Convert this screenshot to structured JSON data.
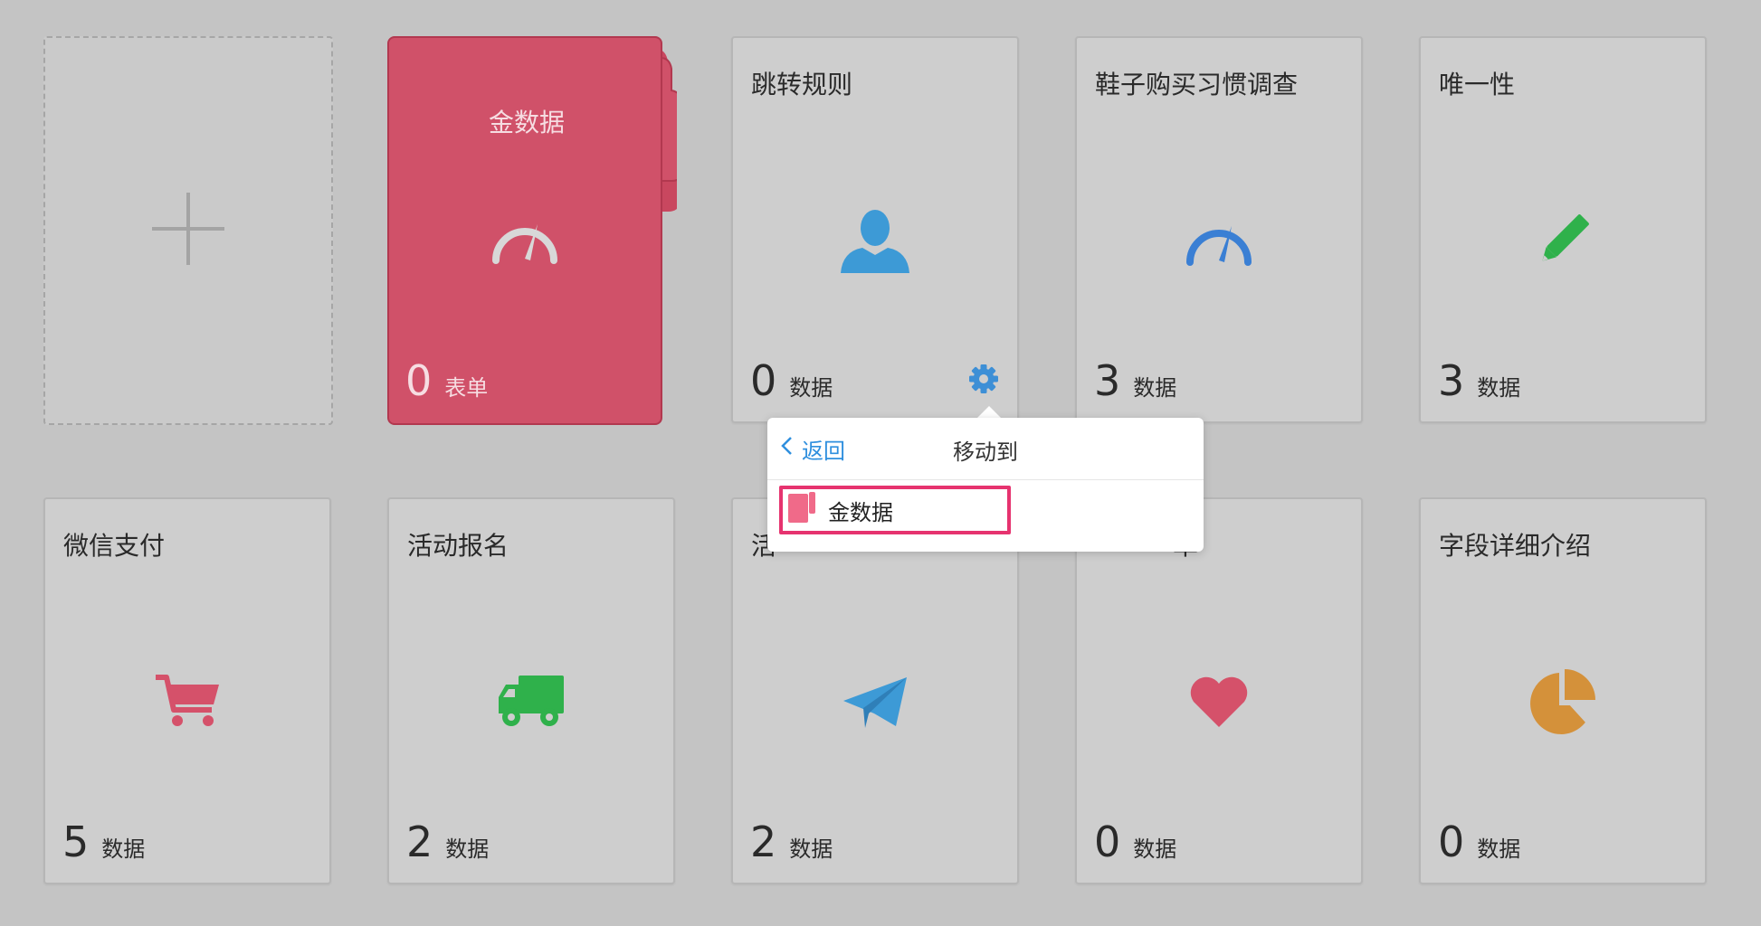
{
  "new_card": {
    "icon": "plus-icon"
  },
  "folder": {
    "title": "金数据",
    "count": "0",
    "unit": "表单",
    "color": "#d05169",
    "icon": "speedometer-icon"
  },
  "cards": [
    {
      "title": "跳转规则",
      "count": "0",
      "unit": "数据",
      "icon": "user-icon",
      "color": "#3d9ad6"
    },
    {
      "title": "鞋子购买习惯调查",
      "count": "3",
      "unit": "数据",
      "icon": "speedometer-icon",
      "color": "#3a7fd4"
    },
    {
      "title": "唯一性",
      "count": "3",
      "unit": "数据",
      "icon": "pencil-icon",
      "color": "#2fb14b"
    },
    {
      "title": "微信支付",
      "count": "5",
      "unit": "数据",
      "icon": "cart-icon",
      "color": "#d5516a"
    },
    {
      "title": "活动报名",
      "count": "2",
      "unit": "数据",
      "icon": "truck-icon",
      "color": "#2fb14b"
    },
    {
      "title": "活",
      "count": "2",
      "unit": "数据",
      "icon": "paper-plane-icon",
      "color": "#3d9ad6"
    },
    {
      "title": "单",
      "count": "0",
      "unit": "数据",
      "icon": "heart-icon",
      "color": "#d5516a"
    },
    {
      "title": "字段详细介绍",
      "count": "0",
      "unit": "数据",
      "icon": "pie-chart-icon",
      "color": "#d4913a"
    }
  ],
  "settings": {
    "icon": "gear-icon",
    "color": "#3d8fd6"
  },
  "popover": {
    "back_label": "返回",
    "title": "移动到",
    "option": {
      "label": "金数据",
      "icon": "folder-icon",
      "color": "#f06a89"
    }
  }
}
